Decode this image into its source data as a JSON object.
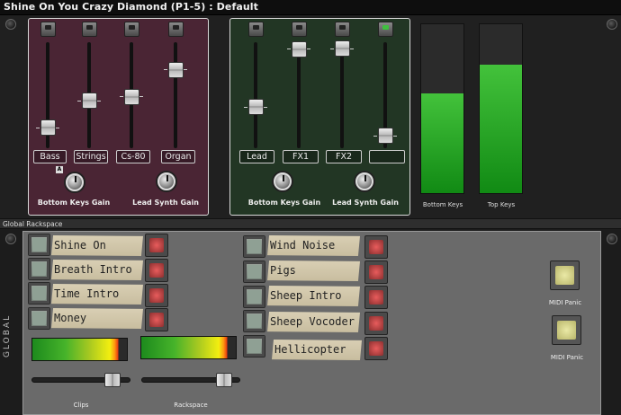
{
  "title": "Shine On You Crazy Diamond (P1-5) : Default",
  "panel_left": {
    "faders": [
      {
        "label": "Bass",
        "level": 0.13
      },
      {
        "label": "Strings",
        "level": 0.36
      },
      {
        "label": "Cs-80",
        "level": 0.38
      },
      {
        "label": "Organ",
        "level": 0.66
      }
    ],
    "a_badge": "A",
    "knob_labels": [
      "Bottom Keys Gain",
      "Lead Synth Gain"
    ]
  },
  "panel_right": {
    "faders": [
      {
        "label": "Lead",
        "level": 0.3
      },
      {
        "label": "FX1",
        "level": 0.85
      },
      {
        "label": "FX2",
        "level": 0.86
      },
      {
        "label": "",
        "level": 0.05
      }
    ],
    "knob_labels": [
      "Bottom Keys Gain",
      "Lead Synth Gain"
    ]
  },
  "meters": [
    {
      "label": "Bottom Keys",
      "level": 0.59
    },
    {
      "label": "Top Keys",
      "level": 0.76
    }
  ],
  "global_bar": "Global Rackspace",
  "vertical_label": "GLOBAL",
  "left_songs": [
    "Shine On",
    "Breath Intro",
    "Time Intro",
    "Money"
  ],
  "right_songs": [
    "Wind Noise",
    "Pigs",
    "Sheep Intro",
    "Sheep Vocoder",
    "Hellicopter"
  ],
  "slider_labels": [
    "Clips",
    "Rackspace"
  ],
  "slider_levels": [
    0.82,
    0.83
  ],
  "midi_panic_labels": [
    "MIDI Panic",
    "MIDI Panic"
  ],
  "colors": {
    "purple_panel": "#4a2534",
    "green_panel": "#223624",
    "meter_green": "#22a31e",
    "red_button": "#d65050"
  }
}
